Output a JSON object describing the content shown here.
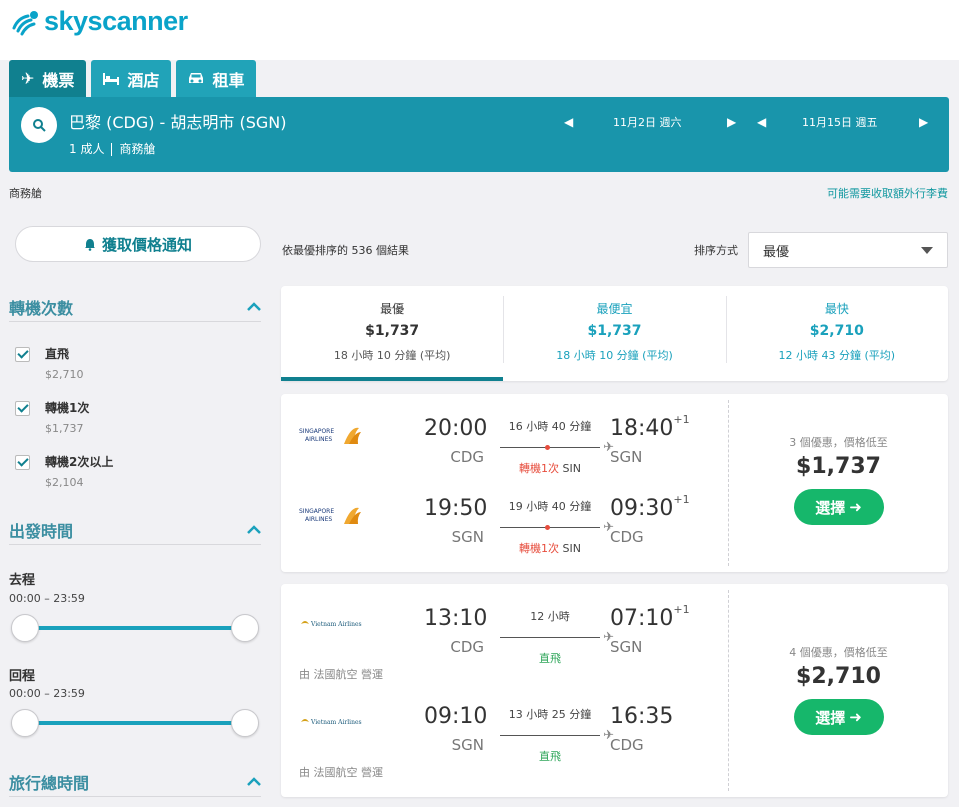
{
  "brand": {
    "name": "skyscanner",
    "color": "#0aa3c9"
  },
  "tabs": [
    {
      "label": "機票",
      "icon": "plane-icon"
    },
    {
      "label": "酒店",
      "icon": "bed-icon"
    },
    {
      "label": "租車",
      "icon": "car-icon"
    }
  ],
  "search": {
    "route": "巴黎 (CDG) - 胡志明市 (SGN)",
    "passengers": "1 成人",
    "cabin": "商務艙",
    "depart_date": "11月2日 週六",
    "return_date": "11月15日 週五"
  },
  "subheader": {
    "cabin": "商務艙",
    "baggage_link": "可能需要收取額外行李費"
  },
  "sidebar": {
    "alert_button": "獲取價格通知",
    "stops": {
      "title": "轉機次數",
      "options": [
        {
          "label": "直飛",
          "price": "$2,710"
        },
        {
          "label": "轉機1次",
          "price": "$1,737"
        },
        {
          "label": "轉機2次以上",
          "price": "$2,104"
        }
      ]
    },
    "departure_times": {
      "title": "出發時間",
      "outbound_label": "去程",
      "outbound_range": "00:00 – 23:59",
      "return_label": "回程",
      "return_range": "00:00 – 23:59"
    },
    "duration": {
      "title": "旅行總時間"
    }
  },
  "results": {
    "count_text": "依最優排序的 536 個結果",
    "sort_label": "排序方式",
    "sort_value": "最優"
  },
  "sort_tabs": [
    {
      "name": "最優",
      "price": "$1,737",
      "duration": "18 小時 10 分鐘 (平均)"
    },
    {
      "name": "最便宜",
      "price": "$1,737",
      "duration": "18 小時 10 分鐘 (平均)"
    },
    {
      "name": "最快",
      "price": "$2,710",
      "duration": "12 小時 43 分鐘 (平均)"
    }
  ],
  "cards": [
    {
      "legs": [
        {
          "airline": "SINGAPORE AIRLINES",
          "dep_time": "20:00",
          "dep_code": "CDG",
          "duration": "16 小時 40 分鐘",
          "stop_red": "轉機1次",
          "stop_via": "SIN",
          "arr_time": "18:40",
          "arr_plus": "+1",
          "arr_code": "SGN"
        },
        {
          "airline": "SINGAPORE AIRLINES",
          "dep_time": "19:50",
          "dep_code": "SGN",
          "duration": "19 小時 40 分鐘",
          "stop_red": "轉機1次",
          "stop_via": "SIN",
          "arr_time": "09:30",
          "arr_plus": "+1",
          "arr_code": "CDG"
        }
      ],
      "deals": "3 個優惠，價格低至",
      "price": "$1,737",
      "button": "選擇"
    },
    {
      "legs": [
        {
          "airline": "Vietnam Airlines",
          "dep_time": "13:10",
          "dep_code": "CDG",
          "duration": "12 小時",
          "stop_direct": "直飛",
          "arr_time": "07:10",
          "arr_plus": "+1",
          "arr_code": "SGN",
          "operated": "由 法國航空 營運"
        },
        {
          "airline": "Vietnam Airlines",
          "dep_time": "09:10",
          "dep_code": "SGN",
          "duration": "13 小時 25 分鐘",
          "stop_direct": "直飛",
          "arr_time": "16:35",
          "arr_plus": "",
          "arr_code": "CDG",
          "operated": "由 法國航空 營運"
        }
      ],
      "deals": "4 個優惠，價格低至",
      "price": "$2,710",
      "button": "選擇"
    }
  ]
}
